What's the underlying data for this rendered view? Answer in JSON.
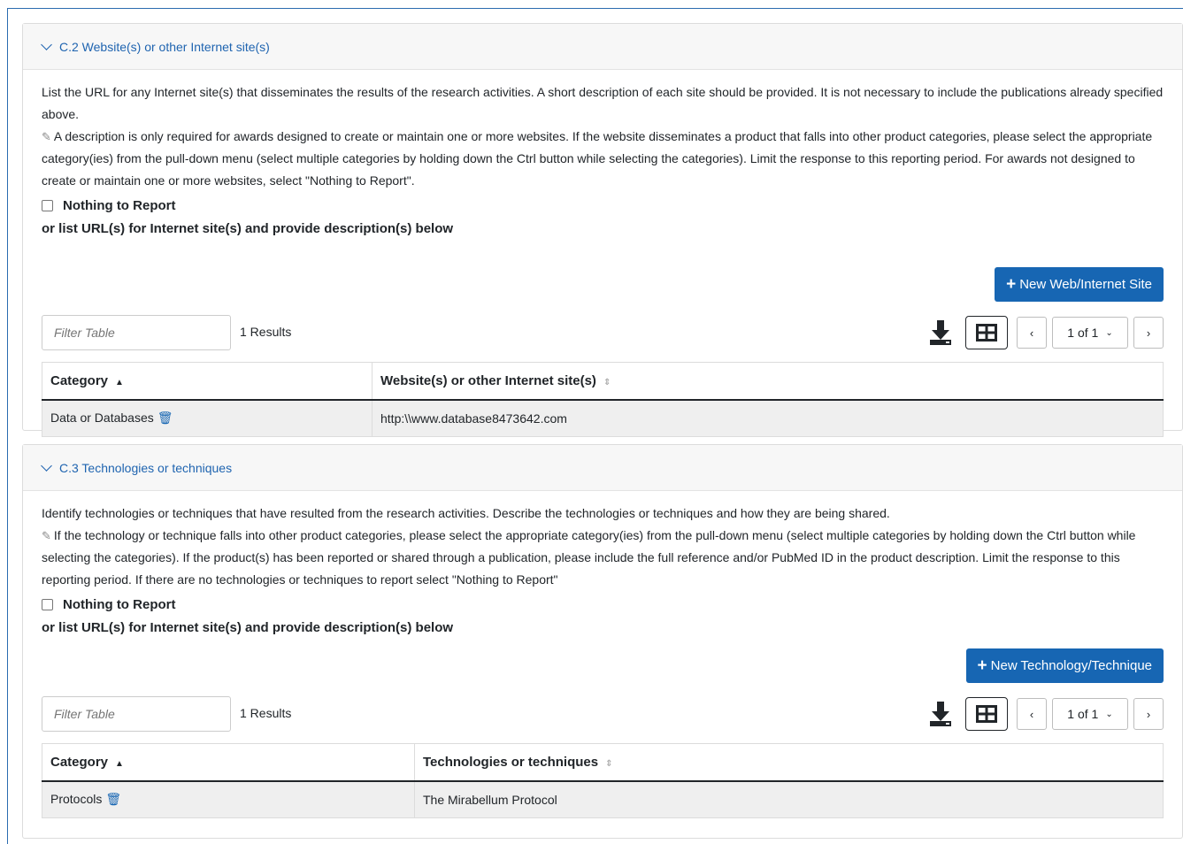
{
  "sections": [
    {
      "title": "C.2 Website(s) or other Internet site(s)",
      "description": "List the URL for any Internet site(s) that disseminates the results of the research activities. A short description of each site should be provided. It is not necessary to include the publications already specified above.",
      "note": "A description is only required for awards designed to create or maintain one or more websites. If the website disseminates a product that falls into other product categories, please select the appropriate category(ies) from the pull-down menu (select multiple categories by holding down the Ctrl button while selecting the categories). Limit the response to this reporting period. For awards not designed to create or maintain one or more websites, select \"Nothing to Report\".",
      "nothing_to_report": "Nothing to Report",
      "or_list": "or list URL(s) for Internet site(s) and provide description(s) below",
      "new_button": "New Web/Internet Site",
      "filter_placeholder": "Filter Table",
      "results": "1 Results",
      "page": "1 of 1",
      "columns": [
        "Category",
        "Website(s) or other Internet site(s)"
      ],
      "rows": [
        [
          "Data or Databases",
          "http:\\\\www.database8473642.com"
        ]
      ]
    },
    {
      "title": "C.3 Technologies or techniques",
      "description": "Identify technologies or techniques that have resulted from the research activities. Describe the technologies or techniques and how they are being shared.",
      "note": "If the technology or technique falls into other product categories, please select the appropriate category(ies) from the pull-down menu (select multiple categories by holding down the Ctrl button while selecting the categories). If the product(s) has been reported or shared through a publication, please include the full reference and/or PubMed ID in the product description. Limit the response to this reporting period. If there are no technologies or techniques to report select \"Nothing to Report\"",
      "nothing_to_report": "Nothing to Report",
      "or_list": "or list URL(s) for Internet site(s) and provide description(s) below",
      "new_button": "New Technology/Technique",
      "filter_placeholder": "Filter Table",
      "results": "1 Results",
      "page": "1 of 1",
      "columns": [
        "Category",
        "Technologies or techniques"
      ],
      "rows": [
        [
          "Protocols",
          "The Mirabellum Protocol"
        ]
      ]
    }
  ],
  "icons": {
    "collapse": "chevron-down-icon",
    "note": "pencil-note-icon",
    "add": "plus-icon",
    "download": "download-icon",
    "columns": "table-columns-icon",
    "prev": "chevron-left-icon",
    "next": "chevron-right-icon",
    "delete": "trash-icon"
  },
  "colors": {
    "accent": "#1766b3",
    "link": "#1f64b0",
    "row_bg": "#efefef"
  }
}
